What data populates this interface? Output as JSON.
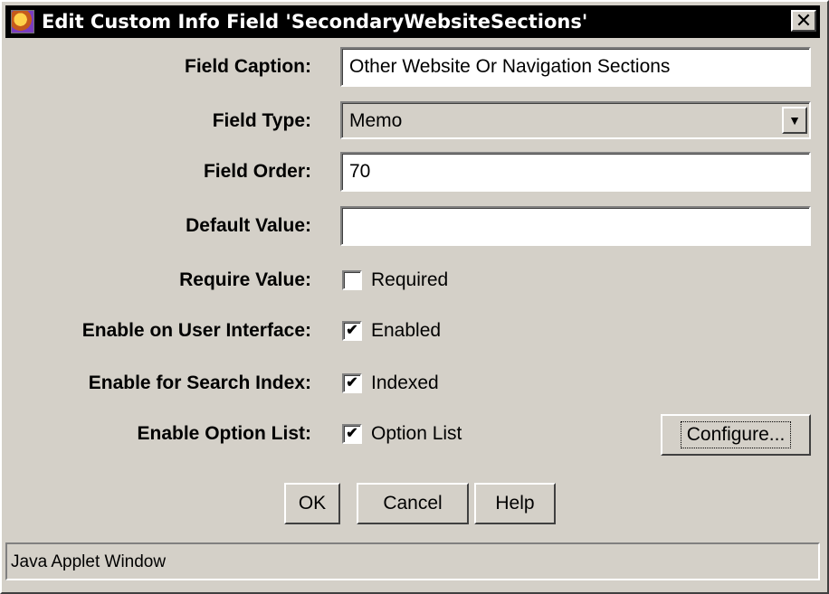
{
  "window": {
    "title": "Edit Custom Info Field 'SecondaryWebsiteSections'"
  },
  "form": {
    "field_caption": {
      "label": "Field Caption:",
      "value": "Other  Website Or Navigation Sections"
    },
    "field_type": {
      "label": "Field Type:",
      "value": "Memo"
    },
    "field_order": {
      "label": "Field Order:",
      "value": "70"
    },
    "default_value": {
      "label": "Default Value:",
      "value": ""
    },
    "require_value": {
      "label": "Require Value:",
      "checkbox_label": "Required",
      "checked": false
    },
    "enable_ui": {
      "label": "Enable on User Interface:",
      "checkbox_label": "Enabled",
      "checked": true
    },
    "enable_search": {
      "label": "Enable for Search Index:",
      "checkbox_label": "Indexed",
      "checked": true
    },
    "enable_option_list": {
      "label": "Enable Option List:",
      "checkbox_label": "Option List",
      "checked": true,
      "configure_label": "Configure..."
    }
  },
  "buttons": {
    "ok": "OK",
    "cancel": "Cancel",
    "help": "Help"
  },
  "status_bar": "Java Applet Window",
  "icons": {
    "app": "applet-icon",
    "close": "close-icon",
    "dropdown": "chevron-down-icon",
    "check": "checkmark-icon"
  }
}
